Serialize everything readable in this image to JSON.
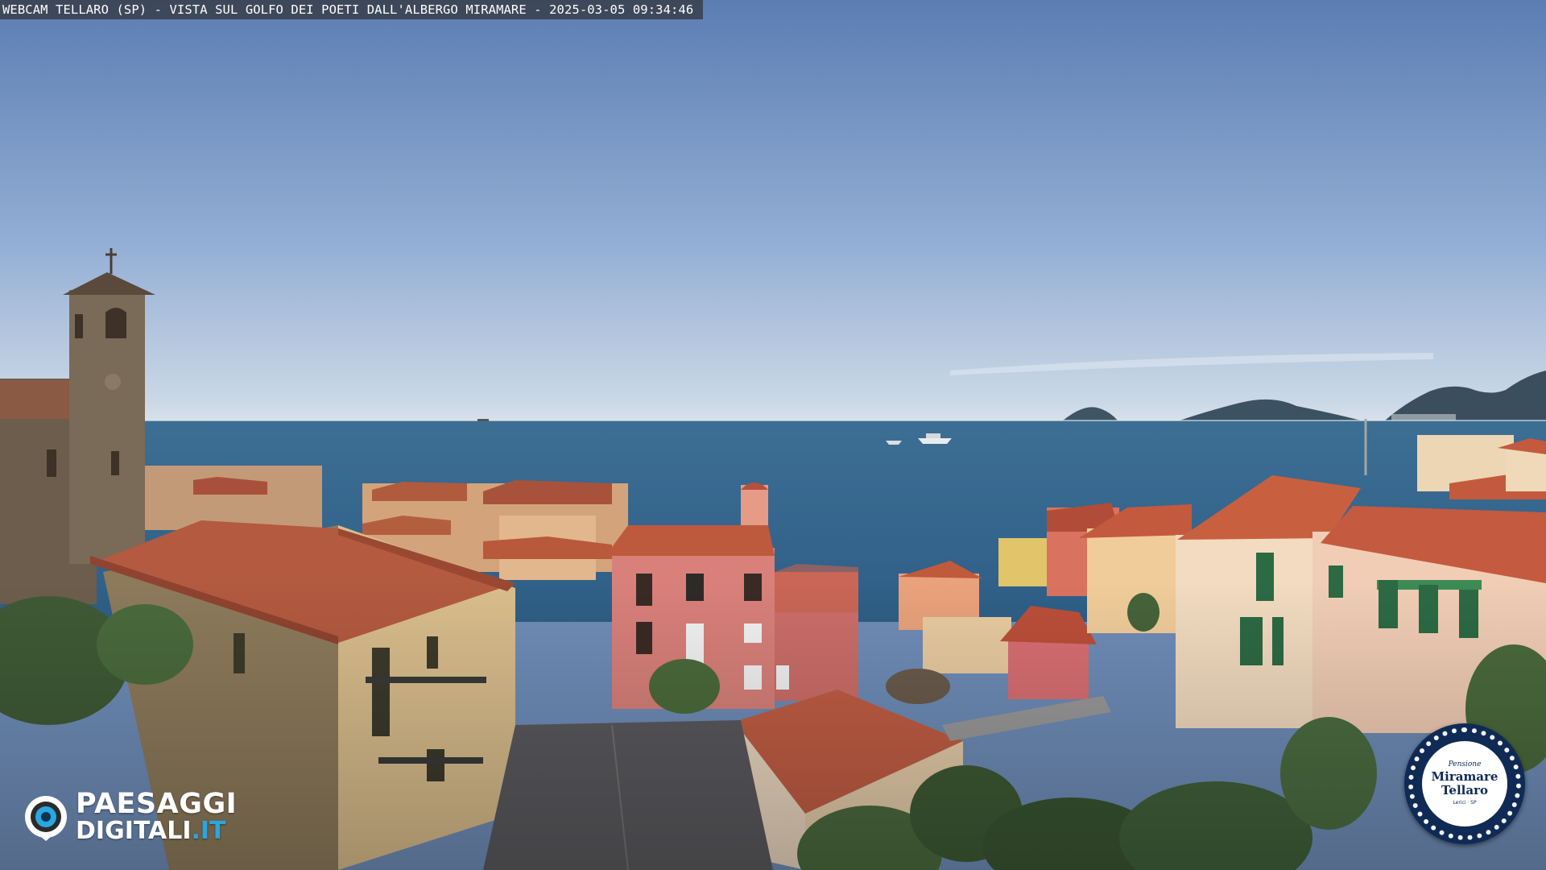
{
  "overlay": {
    "caption": "WEBCAM TELLARO (SP) - VISTA SUL GOLFO DEI POETI DALL'ALBERGO MIRAMARE - 2025-03-05 09:34:46"
  },
  "watermark": {
    "line1": "PAESAGGI",
    "line2_main": "DIGITALI",
    "line2_tld": ".IT",
    "icon": "eye-icon"
  },
  "badge": {
    "small_script": "Pensione",
    "name_line1": "Miramare",
    "name_line2": "Tellaro",
    "tiny_text": "Lerici · SP",
    "colors": {
      "navy": "#0f2a55",
      "white": "#ffffff"
    }
  },
  "colors": {
    "sky_top": "#5d7fb3",
    "sky_horizon": "#cfdbe6",
    "sea": "#3d6f95",
    "roof": "#b9563c",
    "accent_blue": "#2aa6e0"
  }
}
